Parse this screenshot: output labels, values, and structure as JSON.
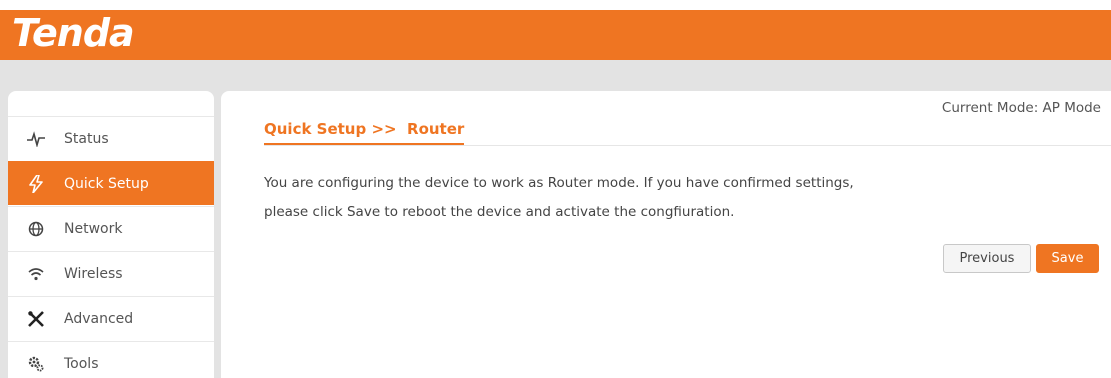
{
  "brand": {
    "logo_text": "Tenda",
    "accent_color": "#ef7522"
  },
  "sidebar": {
    "items": [
      {
        "label": "Status",
        "icon": "pulse-icon",
        "active": false
      },
      {
        "label": "Quick Setup",
        "icon": "lightning-icon",
        "active": true
      },
      {
        "label": "Network",
        "icon": "globe-icon",
        "active": false
      },
      {
        "label": "Wireless",
        "icon": "wifi-icon",
        "active": false
      },
      {
        "label": "Advanced",
        "icon": "tools-icon",
        "active": false
      },
      {
        "label": "Tools",
        "icon": "gears-icon",
        "active": false
      }
    ]
  },
  "main": {
    "current_mode": "Current Mode: AP Mode",
    "breadcrumb": "Quick Setup >>  Router",
    "message_line1": "You are configuring the device to work as Router mode. If you have confirmed settings,",
    "message_line2": "please click Save to reboot the device and activate the congfiuration.",
    "previous_label": "Previous",
    "save_label": "Save"
  }
}
